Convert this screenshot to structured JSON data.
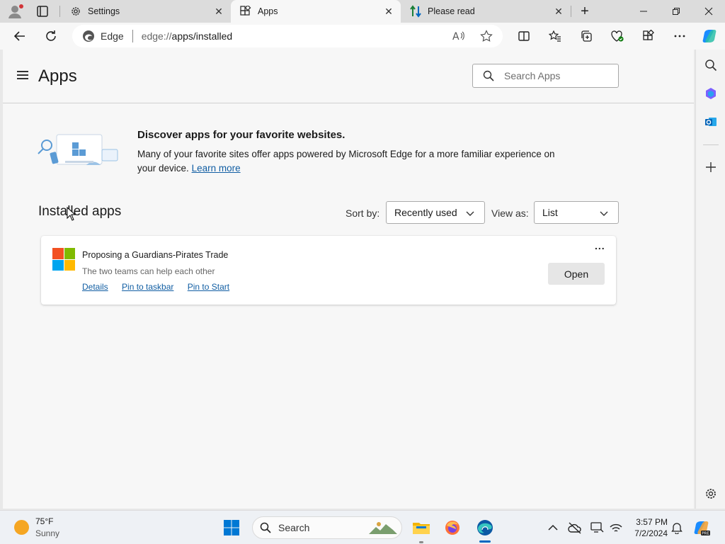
{
  "tabs": [
    {
      "label": "Settings",
      "icon": "gear-icon"
    },
    {
      "label": "Apps",
      "icon": "apps-icon"
    },
    {
      "label": "Please read",
      "icon": "up-down-arrows-icon"
    }
  ],
  "address": {
    "site_label": "Edge",
    "url_prefix": "edge://",
    "url_path": "apps/installed"
  },
  "page": {
    "title": "Apps",
    "search_placeholder": "Search Apps"
  },
  "discover": {
    "title": "Discover apps for your favorite websites.",
    "body": "Many of your favorite sites offer apps powered by Microsoft Edge for a more familiar experience on your device.",
    "link": "Learn more"
  },
  "installed": {
    "title": "Installed apps",
    "sort_label": "Sort by:",
    "sort_value": "Recently used",
    "view_label": "View as:",
    "view_value": "List",
    "apps": [
      {
        "name": "Proposing a Guardians-Pirates Trade",
        "description": "The two teams can help each other",
        "links": [
          "Details",
          "Pin to taskbar",
          "Pin to Start"
        ],
        "open_label": "Open",
        "more_label": "..."
      }
    ]
  },
  "taskbar": {
    "weather_temp": "75°F",
    "weather_cond": "Sunny",
    "search_label": "Search",
    "time": "3:57 PM",
    "date": "7/2/2024"
  },
  "colors": {
    "accent": "#0067c0",
    "link": "#115ea3"
  }
}
